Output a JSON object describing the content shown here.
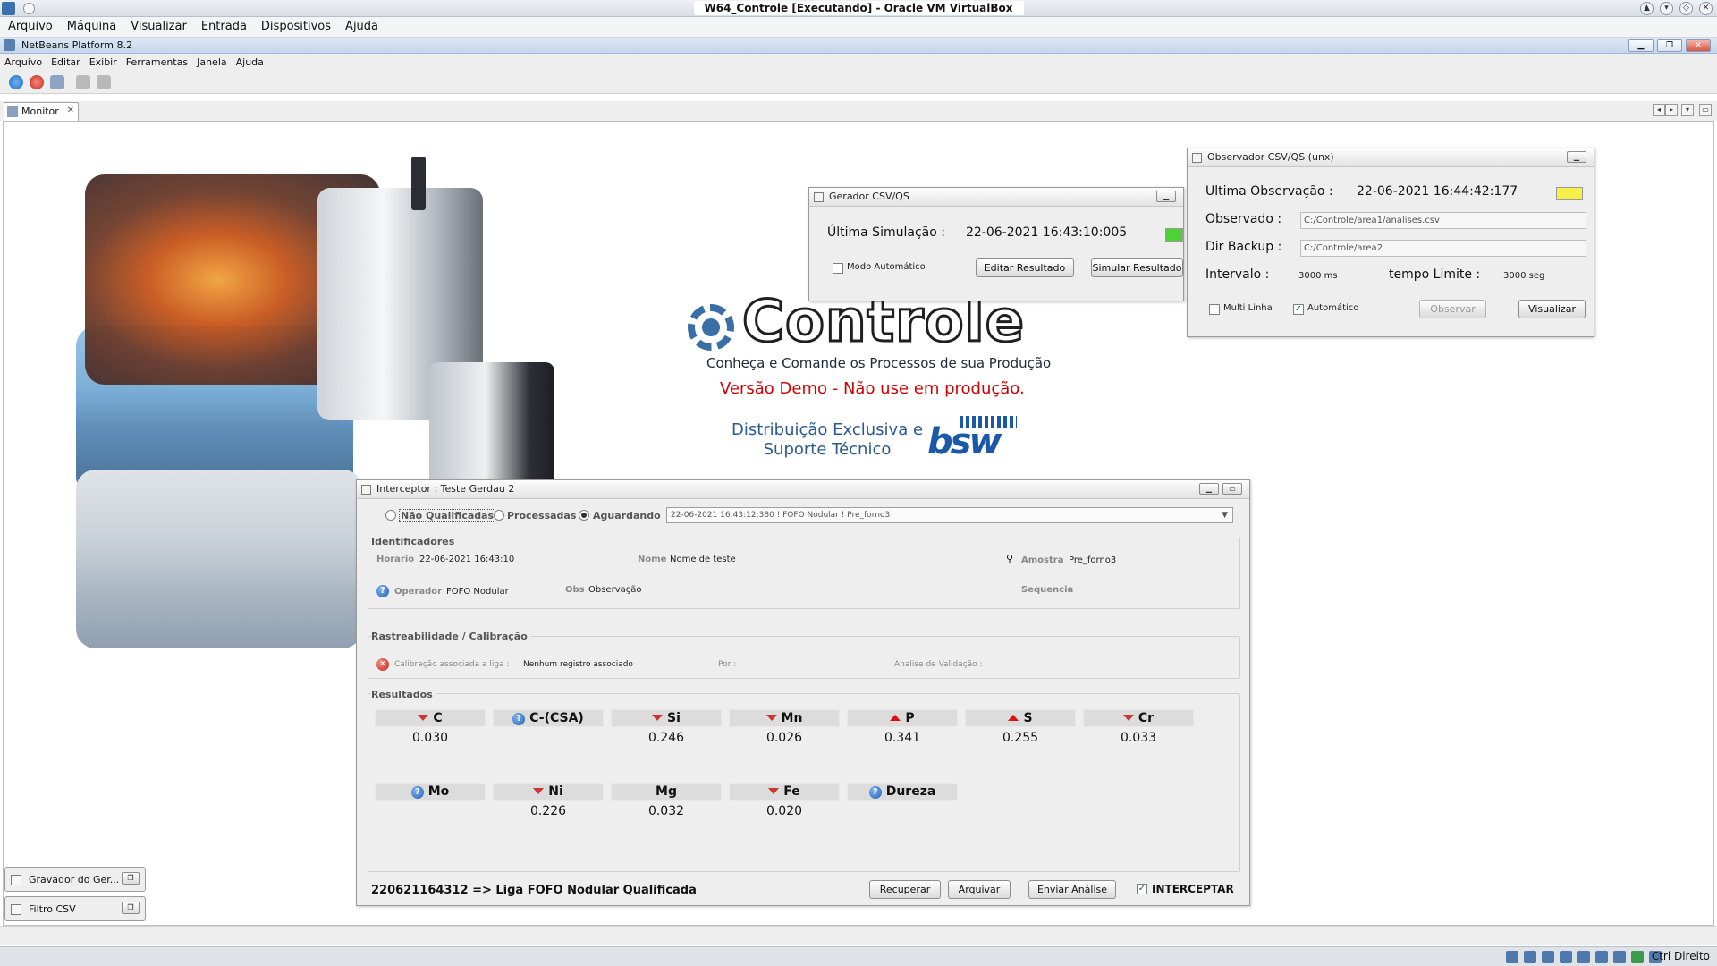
{
  "vbox": {
    "title": "W64_Controle [Executando] - Oracle VM VirtualBox",
    "menu": [
      "Arquivo",
      "Máquina",
      "Visualizar",
      "Entrada",
      "Dispositivos",
      "Ajuda"
    ],
    "host_key": "Ctrl Direito"
  },
  "netbeans": {
    "title": "NetBeans Platform 8.2",
    "menu": [
      "Arquivo",
      "Editar",
      "Exibir",
      "Ferramentas",
      "Janela",
      "Ajuda"
    ],
    "tab_label": "Monitor"
  },
  "brand": {
    "title": "Controle",
    "subtitle": "Conheça e Comande os Processos de sua Produção",
    "warning": "Versão Demo - Não use em produção.",
    "distribution_line1": "Distribuição Exclusiva e",
    "distribution_line2": "Suporte Técnico",
    "logo_text": "bsw",
    "warning_color": "#d40000"
  },
  "gerador": {
    "title": "Gerador CSV/QS",
    "last_sim_label": "Última Simulação :",
    "last_sim_value": "22-06-2021 16:43:10:005",
    "status_color": "#4cd137",
    "auto_mode_label": "Modo Automático",
    "auto_mode_checked": false,
    "edit_button": "Editar Resultado",
    "simulate_button": "Simular Resultado"
  },
  "observador": {
    "title": "Observador CSV/QS (unx)",
    "last_obs_label": "Ultima Observação :",
    "last_obs_value": "22-06-2021 16:44:42:177",
    "status_color": "#f5ef4a",
    "observed_label": "Observado :",
    "observed_value": "C:/Controle/area1/analises.csv",
    "backup_label": "Dir Backup :",
    "backup_value": "C:/Controle/area2",
    "interval_label": "Intervalo :",
    "interval_value": "3000 ms",
    "limit_label": "tempo Limite :",
    "limit_value": "3000 seg",
    "multiline_label": "Multi Linha",
    "multiline_checked": false,
    "auto_label": "Automático",
    "auto_checked": true,
    "observe_button": "Observar",
    "view_button": "Visualizar"
  },
  "interceptor": {
    "title": "Interceptor : Teste Gerdau 2",
    "filters": [
      {
        "label": "Não Qualificadas",
        "selected": false
      },
      {
        "label": "Processadas",
        "selected": false
      },
      {
        "label": "Aguardando",
        "selected": true
      }
    ],
    "selected_record": "22-06-2021 16:43:12:380 ! FOFO Nodular ! Pre_forno3",
    "identificadores": {
      "section_title": "Identificadores",
      "horario_label": "Horario",
      "horario_value": "22-06-2021 16:43:10",
      "nome_label": "Nome",
      "nome_value": "Nome de teste",
      "amostra_label": "Amostra",
      "amostra_value": "Pre_forno3",
      "operador_label": "Operador",
      "operador_value": "FOFO Nodular",
      "obs_label": "Obs",
      "obs_value": "Observação",
      "sequencia_label": "Sequencia"
    },
    "rastreabilidade": {
      "section_title": "Rastreabilidade / Calibração",
      "calib_label": "Calibração associada a liga :",
      "calib_value": "Nenhum registro associado",
      "por_label": "Por :",
      "analise_label": "Analise de Validação :"
    },
    "resultados": {
      "section_title": "Resultados",
      "items": [
        {
          "element": "C",
          "value": "0.030",
          "indicator": "down"
        },
        {
          "element": "C-(CSA)",
          "value": "",
          "indicator": "question"
        },
        {
          "element": "Si",
          "value": "0.246",
          "indicator": "down"
        },
        {
          "element": "Mn",
          "value": "0.026",
          "indicator": "down"
        },
        {
          "element": "P",
          "value": "0.341",
          "indicator": "up"
        },
        {
          "element": "S",
          "value": "0.255",
          "indicator": "up"
        },
        {
          "element": "Cr",
          "value": "0.033",
          "indicator": "down"
        },
        {
          "element": "Mo",
          "value": "",
          "indicator": "question"
        },
        {
          "element": "Ni",
          "value": "0.226",
          "indicator": "down"
        },
        {
          "element": "Mg",
          "value": "0.032",
          "indicator": "none"
        },
        {
          "element": "Fe",
          "value": "0.020",
          "indicator": "down"
        },
        {
          "element": "Dureza",
          "value": "",
          "indicator": "question"
        }
      ]
    },
    "footer_status": "220621164312 => Liga FOFO Nodular Qualificada",
    "recover_button": "Recuperar",
    "archive_button": "Arquivar",
    "send_button": "Enviar Análise",
    "intercept_label": "INTERCEPTAR",
    "intercept_checked": true
  },
  "minimized": [
    {
      "label": "Gravador do Ger..."
    },
    {
      "label": "Filtro CSV"
    }
  ]
}
